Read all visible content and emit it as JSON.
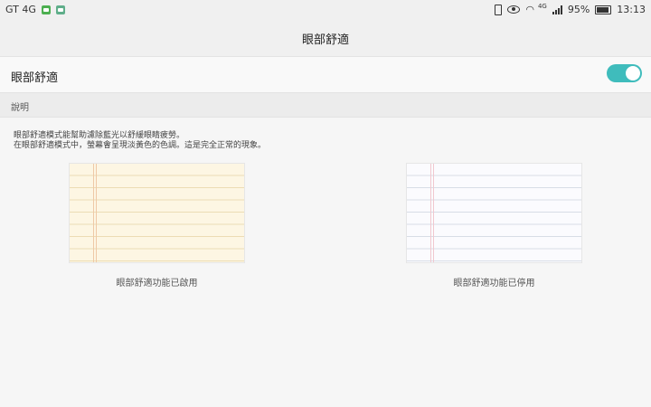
{
  "status_bar": {
    "carrier": "GT 4G",
    "network_type": "4G",
    "battery_percent": "95%",
    "time": "13:13",
    "icons": [
      "message-icon",
      "app-notification-icon",
      "vibrate-icon",
      "eye-comfort-icon",
      "wifi-icon",
      "signal-icon",
      "battery-icon"
    ]
  },
  "title_bar": {
    "title": "眼部舒適"
  },
  "setting": {
    "label": "眼部舒適",
    "enabled": true,
    "toggle_color": "#3fbcbc"
  },
  "section": {
    "header": "說明"
  },
  "description": {
    "line1": "眼部舒適模式能幫助濾除藍光以舒緩眼睛疲勞。",
    "line2": "在眼部舒適模式中，螢幕會呈現淡黃色的色調。這是完全正常的現象。"
  },
  "previews": [
    {
      "caption": "眼部舒適功能已啟用",
      "tint": "#fdf6e3"
    },
    {
      "caption": "眼部舒適功能已停用",
      "tint": "#fbfbfe"
    }
  ]
}
